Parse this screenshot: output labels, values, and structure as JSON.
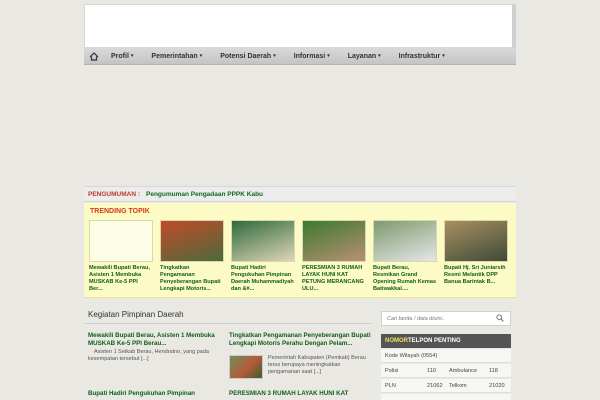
{
  "nav": {
    "home_icon": "home-icon",
    "items": [
      {
        "label": "Profil",
        "caret": "▾"
      },
      {
        "label": "Pemerintahan",
        "caret": "▾"
      },
      {
        "label": "Potensi Daerah",
        "caret": "▾"
      },
      {
        "label": "Informasi",
        "caret": "▾"
      },
      {
        "label": "Layanan",
        "caret": "▾"
      },
      {
        "label": "Infrastruktur",
        "caret": "▾"
      }
    ]
  },
  "announcement": {
    "label": "PENGUMUMAN :",
    "text": "Pengumuman Pengadaan PPPK Kabu"
  },
  "trending": {
    "title": "TRENDING TOPIK",
    "cards": [
      {
        "caption": "Mewakili Bupati Berau, Asisten 1 Membuka MUSKAB Ke-5 PPI Ber...",
        "colors": [
          "#fdfde6",
          "#fdfde6"
        ]
      },
      {
        "caption": "Tingkatkan Pengamanan Penyeberangan Bupati Lengkapi Motoris...",
        "colors": [
          "#c24a2a",
          "#4d6a3a"
        ]
      },
      {
        "caption": "Bupati Hadiri Pengukuhan Pimpinan Daerah Muhammadiyah dan &#...",
        "colors": [
          "#2f6b3c",
          "#e0d4b8"
        ]
      },
      {
        "caption": "PERESMIAN 3 RUMAH LAYAK HUNI KAT PETUNG MERANCANG ULU...",
        "colors": [
          "#3c7a2e",
          "#b98f74"
        ]
      },
      {
        "caption": "Bupati Berau, Resmikan Grand Opening Rumah Kemas Batiwakkal....",
        "colors": [
          "#7f9a70",
          "#e6e6e6"
        ]
      },
      {
        "caption": "Bupati Hj. Sri Juniarsih Resmi Melantik DPP Banua Barintak B...",
        "colors": [
          "#a89060",
          "#404a38"
        ]
      }
    ]
  },
  "main": {
    "section_title": "Kegiatan Pimpinan Daerah",
    "posts": [
      {
        "title": "Mewakili Bupati Berau, Asisten 1 Membuka MUSKAB Ke-5 PPI Berau...",
        "excerpt": "Asisten 1 Setkab Berau, Hendratno, yang pada kesempatan tersebut [...]"
      },
      {
        "title": "Tingkatkan Pengamanan Penyeberangan Bupati Lengkapi Motoris Perahu Dengan Pelam...",
        "excerpt": "Pemerintah Kabupaten (Pemkab) Berau terus berupaya meningkatkan pengamanan saat [...]"
      },
      {
        "title": "Bupati Hadiri Pengukuhan Pimpinan",
        "excerpt": ""
      },
      {
        "title": "PERESMIAN 3 RUMAH LAYAK HUNI KAT",
        "excerpt": ""
      }
    ]
  },
  "sidebar": {
    "search_placeholder": "Cari berita / data disini..",
    "phone_title_a": "NOMOR",
    "phone_title_b": " TELPON PENTING",
    "kode_wilayah": "Kode Wilayah (0554)",
    "rows": [
      {
        "a_name": "Polisi",
        "a_num": "110",
        "b_name": "Ambulance",
        "b_num": "118"
      },
      {
        "a_name": "PLN",
        "a_num": "21062",
        "b_name": "Telkom",
        "b_num": "21020"
      },
      {
        "a_name": "",
        "a_num": "",
        "b_name": "",
        "b_num": ""
      }
    ]
  }
}
